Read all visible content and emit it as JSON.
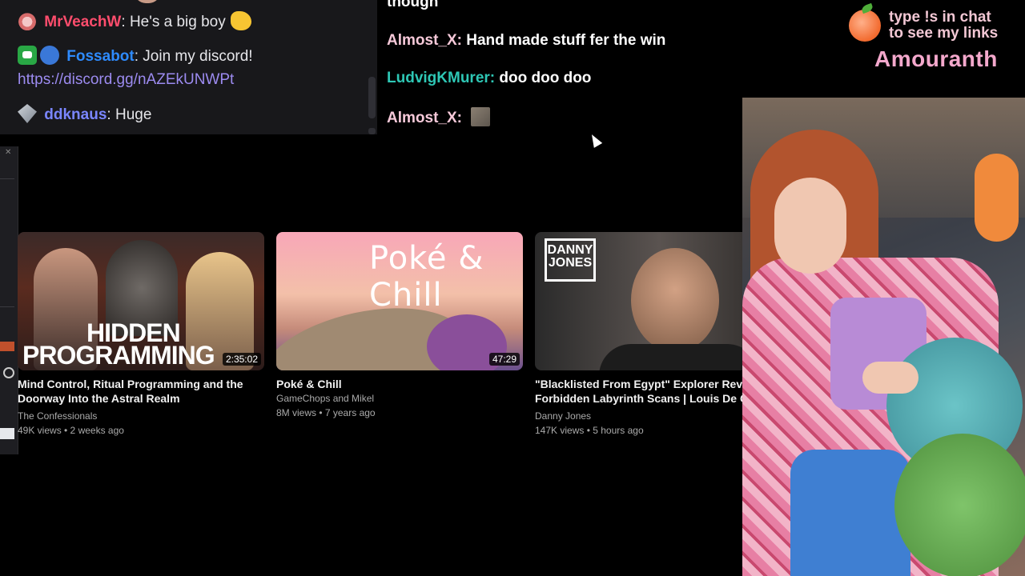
{
  "left_chat": {
    "messages": [
      {
        "user": "MrVeachW",
        "user_color": "#ff4d6d",
        "text": "He's a big boy"
      },
      {
        "user": "Fossabot",
        "user_color": "#2e8bff",
        "text": "Join my discord!"
      },
      {
        "link": "https://discord.gg/nAZEkUNWPt"
      },
      {
        "user": "ddknaus",
        "user_color": "#7a86ff",
        "text": "Huge"
      }
    ]
  },
  "center_chat": {
    "messages": [
      {
        "user": "",
        "text": "though"
      },
      {
        "user": "Almost_X:",
        "text": "Hand made stuff fer the win"
      },
      {
        "user": "LudvigKMurer:",
        "text": "doo doo doo"
      },
      {
        "user": "Almost_X:",
        "text": ""
      }
    ]
  },
  "overlay": {
    "promo_line1": "type !s in chat",
    "promo_line2": "to see my links",
    "streamer": "Amouranth"
  },
  "videos": [
    {
      "title": "Mind Control, Ritual Programming and the",
      "title2": "Doorway Into the Astral Realm",
      "channel": "The Confessionals",
      "meta": "49K views • 2 weeks ago",
      "duration": "2:35:02",
      "thumb_text1": "HIDDEN",
      "thumb_text2": "PROGRAMMING"
    },
    {
      "title": "Poké & Chill",
      "channel": "GameChops and Mikel",
      "meta": "8M views • 7 years ago",
      "duration": "47:29",
      "thumb_text1": "Poké & Chill"
    },
    {
      "title": "\"Blacklisted From Egypt\" Explorer Reve",
      "title2": "Forbidden Labyrinth Scans | Louis De C",
      "channel": "Danny Jones",
      "meta": "147K views • 5 hours ago",
      "thumb_logo": "DANNY JONES"
    }
  ]
}
